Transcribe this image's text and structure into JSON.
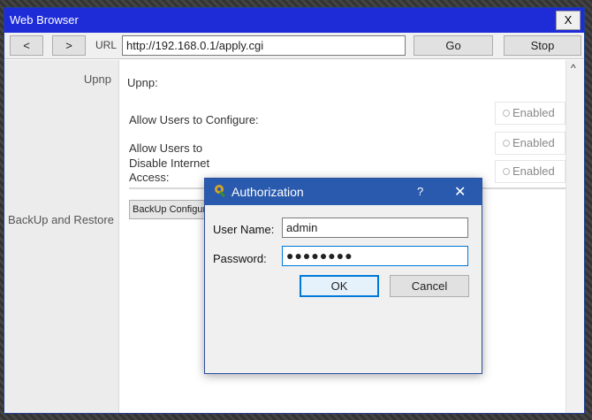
{
  "window": {
    "title": "Web Browser",
    "close_label": "X"
  },
  "toolbar": {
    "back_label": "<",
    "forward_label": ">",
    "url_label": "URL",
    "url_value": "http://192.168.0.1/apply.cgi",
    "go_label": "Go",
    "stop_label": "Stop"
  },
  "sidebar": {
    "upnp_label": "Upnp",
    "backup_label": "BackUp and Restore"
  },
  "content": {
    "upnp_heading": "Upnp:",
    "allow_configure_label": "Allow Users to Configure:",
    "allow_disable_label_line1": "Allow Users to",
    "allow_disable_label_line2": "Disable Internet",
    "allow_disable_label_line3": "Access:",
    "radio_enabled_1": "Enabled",
    "radio_enabled_2": "Enabled",
    "radio_enabled_3": "Enabled",
    "backup_button_label": "BackUp Configuration"
  },
  "scrollbar": {
    "up_arrow": "^"
  },
  "dialog": {
    "title": "Authorization",
    "help_label": "?",
    "close_label": "✕",
    "username_label": "User Name:",
    "username_value": "admin",
    "password_label": "Password:",
    "password_value": "●●●●●●●●",
    "ok_label": "OK",
    "cancel_label": "Cancel"
  },
  "colors": {
    "titlebar": "#1e2cd8",
    "dialog_titlebar": "#2a5aad",
    "focus_accent": "#0078d7"
  }
}
